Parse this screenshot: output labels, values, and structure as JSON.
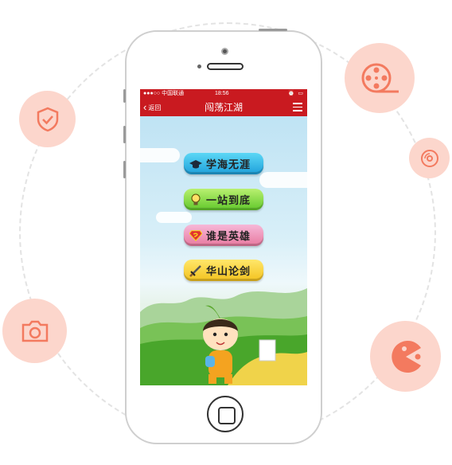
{
  "colors": {
    "accent": "#c91a20",
    "bubble": "#fcd6cc",
    "icon": "#f37a5f"
  },
  "decor_icons": [
    "shield-check-icon",
    "camera-icon",
    "film-reel-icon",
    "disc-icon",
    "pacman-icon"
  ],
  "phone": {
    "statusbar": {
      "carrier": "●●●○○ 中国联通 ",
      "time": "18:56",
      "right_icons": "⏰ ▭"
    },
    "navbar": {
      "back_label": "返回",
      "title": "闯荡江湖",
      "menu_icon": "hamburger-menu-icon"
    },
    "menu": [
      {
        "label": "学海无涯",
        "icon": "graduation-cap-icon"
      },
      {
        "label": "一站到底",
        "icon": "lightbulb-icon"
      },
      {
        "label": "谁是英雄",
        "icon": "superman-icon"
      },
      {
        "label": "华山论剑",
        "icon": "sword-icon"
      }
    ]
  }
}
